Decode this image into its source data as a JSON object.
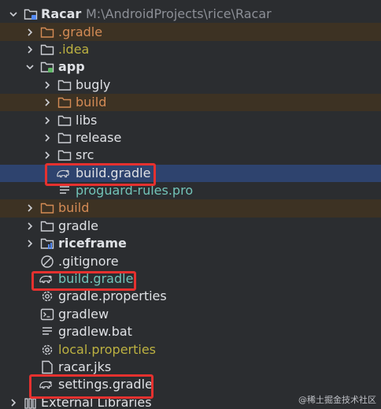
{
  "project": {
    "name": "Racar",
    "path": "M:\\AndroidProjects\\rice\\Racar"
  },
  "items": {
    "gradle_dir": ".gradle",
    "idea_dir": ".idea",
    "app": "app",
    "bugly": "bugly",
    "app_build_dir": "build",
    "libs": "libs",
    "release": "release",
    "src": "src",
    "app_build_gradle": "build.gradle",
    "proguard": "proguard-rules.pro",
    "root_build_dir": "build",
    "gradle": "gradle",
    "riceframe": "riceframe",
    "gitignore": ".gitignore",
    "root_build_gradle": "build.gradle",
    "gradle_properties": "gradle.properties",
    "gradlew": "gradlew",
    "gradlew_bat": "gradlew.bat",
    "local_properties": "local.properties",
    "racar_jks": "racar.jks",
    "settings_gradle": "settings.gradle",
    "external_libraries": "External Libraries"
  },
  "watermark": "@稀土掘金技术社区",
  "colors": {
    "background": "#2b2d30",
    "selection": "#2e436e",
    "excluded_row": "#3d3223",
    "excluded_text": "#d48b55",
    "ignored_text": "#bcb141",
    "modified_text": "#72c3b8",
    "highlight_box": "#e5312f"
  }
}
